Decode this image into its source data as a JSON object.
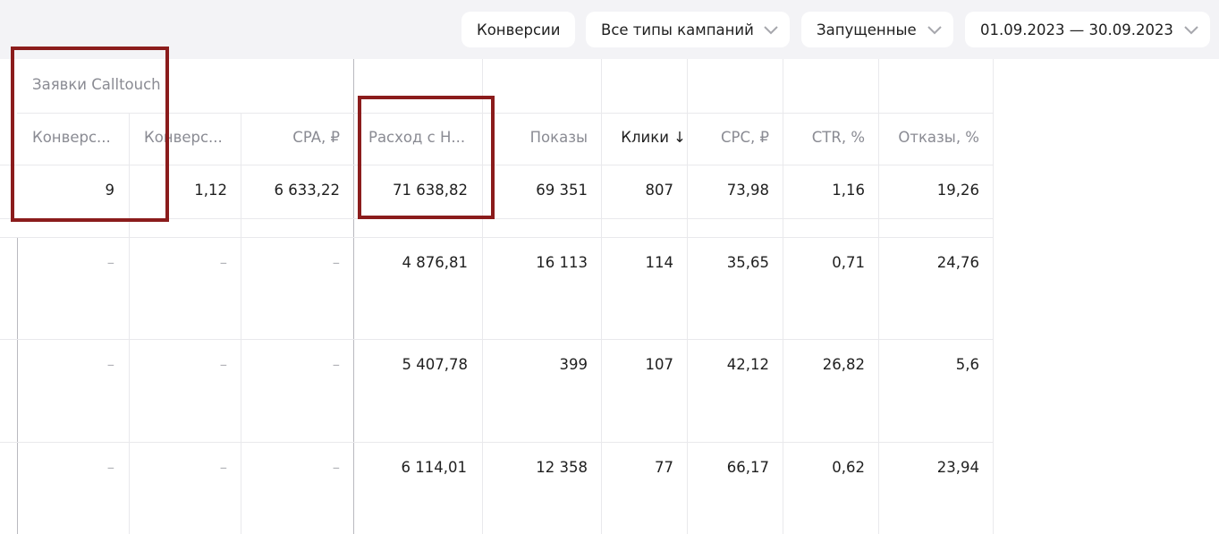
{
  "filters": {
    "conversions_label": "Конверсии",
    "campaign_types_label": "Все типы кампаний",
    "status_label": "Запущенные",
    "date_range_label": "01.09.2023 — 30.09.2023"
  },
  "table": {
    "group_title": "Заявки Calltouch",
    "headers": {
      "conv1": "Конверс...",
      "conv2": "Конверс...",
      "cpa": "CPA, ₽",
      "spend": "Расход с Н...",
      "impressions": "Показы",
      "clicks": "Клики ↓",
      "cpc": "CPC, ₽",
      "ctr": "CTR, %",
      "bounces": "Отказы, %"
    },
    "total": {
      "conv1": "9",
      "conv2": "1,12",
      "cpa": "6 633,22",
      "spend": "71 638,82",
      "impressions": "69 351",
      "clicks": "807",
      "cpc": "73,98",
      "ctr": "1,16",
      "bounces": "19,26"
    },
    "rows": [
      {
        "conv1": "–",
        "conv2": "–",
        "cpa": "–",
        "spend": "4 876,81",
        "impressions": "16 113",
        "clicks": "114",
        "cpc": "35,65",
        "ctr": "0,71",
        "bounces": "24,76"
      },
      {
        "conv1": "–",
        "conv2": "–",
        "cpa": "–",
        "spend": "5 407,78",
        "impressions": "399",
        "clicks": "107",
        "cpc": "42,12",
        "ctr": "26,82",
        "bounces": "5,6"
      },
      {
        "conv1": "–",
        "conv2": "–",
        "cpa": "–",
        "spend": "6 114,01",
        "impressions": "12 358",
        "clicks": "77",
        "cpc": "66,17",
        "ctr": "0,62",
        "bounces": "23,94"
      }
    ]
  },
  "colors": {
    "highlight_box": "#8b1c1c",
    "toolbar_bg": "#f3f3f6",
    "header_text": "#8a8b93"
  },
  "icons": {
    "dropdown": "chevron-down-icon"
  }
}
